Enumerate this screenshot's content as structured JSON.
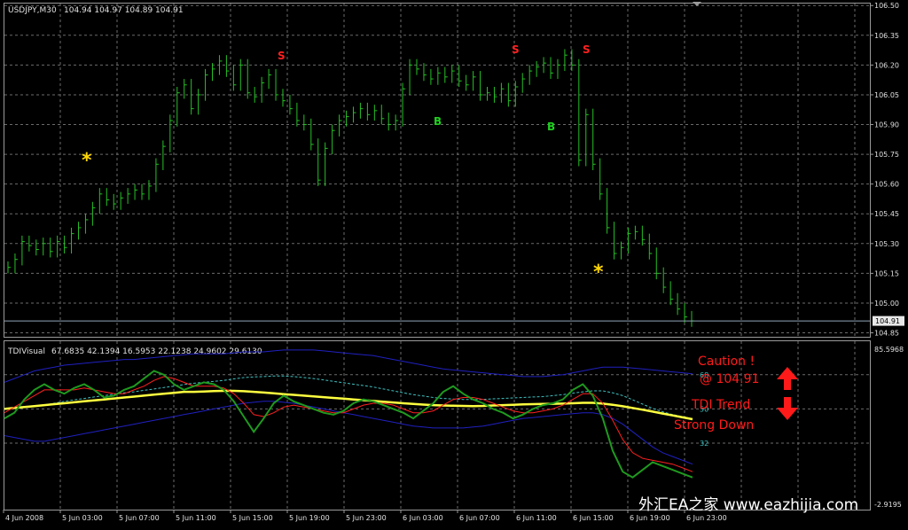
{
  "main_header": {
    "symbol": "USDJPY,M30",
    "ohlc": "104.94 104.97 104.89 104.91"
  },
  "indicator_header": {
    "name": "TDIVisual",
    "values": "67.6835 42.1394 16.5953 22.1238 24.9602 29.6130"
  },
  "price_axis": {
    "ticks": [
      "106.50",
      "106.35",
      "106.20",
      "106.05",
      "105.90",
      "105.75",
      "105.60",
      "105.45",
      "105.30",
      "105.15",
      "105.00",
      "104.85"
    ],
    "current_price": "104.91"
  },
  "indicator_axis": {
    "top_value": "85.5968",
    "bottom_value": "-2.9195",
    "levels": [
      {
        "value": 68,
        "label": "68"
      },
      {
        "value": 50,
        "label": "50"
      },
      {
        "value": 32,
        "label": "32"
      }
    ]
  },
  "time_axis": {
    "labels": [
      "4 Jun 2008",
      "5 Jun 03:00",
      "5 Jun 07:00",
      "5 Jun 11:00",
      "5 Jun 15:00",
      "5 Jun 19:00",
      "5 Jun 23:00",
      "6 Jun 03:00",
      "6 Jun 07:00",
      "6 Jun 11:00",
      "6 Jun 15:00",
      "6 Jun 19:00",
      "6 Jun 23:00"
    ]
  },
  "annotations": {
    "caution_label": "Caution !",
    "caution_price": "@ 104.91",
    "trend_line1": "TDI Trend",
    "trend_line2": "Strong Down"
  },
  "markers": [
    {
      "type": "star",
      "label": "*"
    },
    {
      "type": "sell",
      "label": "S"
    },
    {
      "type": "sell",
      "label": "S"
    },
    {
      "type": "sell",
      "label": "S"
    },
    {
      "type": "buy",
      "label": "B"
    },
    {
      "type": "buy",
      "label": "B"
    },
    {
      "type": "star",
      "label": "*"
    }
  ],
  "watermark": "外汇EA之家 www.eazhijia.com",
  "colors": {
    "background": "#000000",
    "grid": "#6b6b6b",
    "bars": "#26c026",
    "sell": "#ff2020",
    "buy": "#20d020",
    "star": "#ffd800",
    "rsi_price": "#1f9a1f",
    "signal": "#ff2020",
    "market_base": "#ffff40",
    "bands": "#2020c0",
    "mid_band": "#40c0c0",
    "annotation": "#ff1a1a"
  },
  "chart_data": {
    "type": "line",
    "price_range": [
      104.83,
      106.51
    ],
    "indicator_range": [
      -2.9195,
      85.5968
    ],
    "price_bars_close": [
      105.18,
      105.22,
      105.31,
      105.29,
      105.27,
      105.3,
      105.26,
      105.31,
      105.28,
      105.35,
      105.38,
      105.42,
      105.48,
      105.55,
      105.52,
      105.5,
      105.53,
      105.55,
      105.57,
      105.55,
      105.59,
      105.7,
      105.79,
      105.92,
      106.06,
      106.1,
      105.98,
      106.05,
      106.15,
      106.18,
      106.22,
      106.17,
      106.1,
      106.2,
      106.06,
      106.04,
      106.11,
      106.15,
      106.05,
      106.02,
      105.98,
      105.92,
      105.9,
      105.8,
      105.62,
      105.78,
      105.87,
      105.92,
      105.94,
      105.96,
      105.98,
      105.95,
      105.97,
      105.93,
      105.9,
      105.92,
      106.08,
      106.2,
      106.18,
      106.15,
      106.13,
      106.16,
      106.14,
      106.17,
      106.12,
      106.1,
      106.14,
      106.05,
      106.06,
      106.04,
      106.08,
      106.02,
      106.09,
      106.13,
      106.17,
      106.19,
      106.21,
      106.16,
      106.2,
      106.25,
      106.2,
      105.72,
      105.95,
      105.7,
      105.55,
      105.38,
      105.25,
      105.28,
      105.35,
      105.36,
      105.32,
      105.25,
      105.15,
      105.08,
      105.02,
      104.97,
      104.93,
      104.91
    ],
    "tdi_rsi_price": [
      45,
      48,
      55,
      60,
      63,
      60,
      58,
      61,
      63,
      60,
      56,
      57,
      60,
      62,
      66,
      70,
      68,
      63,
      60,
      62,
      64,
      63,
      60,
      54,
      46,
      38,
      45,
      53,
      57,
      54,
      52,
      50,
      48,
      47,
      49,
      53,
      55,
      54,
      52,
      50,
      48,
      45,
      49,
      53,
      59,
      62,
      58,
      55,
      53,
      50,
      48,
      45,
      47,
      50,
      52,
      53,
      55,
      60,
      63,
      57,
      45,
      28,
      17,
      14,
      18,
      22,
      20,
      18,
      16,
      14
    ],
    "tdi_signal": [
      48,
      51,
      54,
      57,
      60,
      60,
      60,
      60,
      61,
      60,
      59,
      58,
      58,
      60,
      62,
      65,
      67,
      66,
      64,
      62,
      62,
      62,
      61,
      58,
      53,
      47,
      46,
      48,
      51,
      52,
      51,
      50,
      49,
      48,
      48,
      50,
      52,
      53,
      53,
      52,
      50,
      48,
      48,
      49,
      52,
      55,
      56,
      56,
      55,
      53,
      51,
      49,
      48,
      48,
      49,
      50,
      52,
      55,
      58,
      58,
      53,
      44,
      34,
      27,
      24,
      23,
      22,
      21,
      19,
      17
    ],
    "tdi_market_base": [
      50,
      50.5,
      51,
      51.5,
      52,
      52.5,
      53,
      53.5,
      54,
      54.5,
      55,
      55.5,
      56,
      56.5,
      57,
      57.5,
      58,
      58.5,
      59,
      59,
      59.2,
      59.4,
      59.5,
      59.5,
      59.3,
      59,
      58.6,
      58.2,
      57.8,
      57.4,
      57,
      56.6,
      56.2,
      55.8,
      55.4,
      55,
      54.6,
      54.2,
      53.8,
      53.4,
      53,
      52.6,
      52.3,
      52,
      51.8,
      51.7,
      51.6,
      51.5,
      51.6,
      51.8,
      52,
      52.2,
      52.4,
      52.5,
      52.6,
      52.7,
      52.8,
      53,
      53.2,
      53.2,
      52.8,
      52.2,
      51.4,
      50.5,
      49.6,
      48.6,
      47.6,
      46.6,
      45.6,
      44.6
    ],
    "tdi_upper_band": [
      64,
      66,
      68,
      70,
      71,
      72,
      73,
      73.5,
      74,
      74.5,
      75,
      75.5,
      76,
      76,
      76.5,
      77,
      77.5,
      78,
      78.5,
      79,
      79,
      79,
      79,
      79.5,
      80,
      80,
      80,
      80.5,
      81,
      81,
      81,
      81,
      80.5,
      80,
      79.5,
      79,
      78.5,
      78,
      77,
      76,
      75,
      74,
      73,
      72,
      71,
      70.5,
      70,
      69.5,
      69,
      68.5,
      68,
      67.5,
      67,
      67,
      67,
      67.5,
      68,
      69,
      70,
      71,
      72,
      72,
      72,
      71.5,
      71,
      70.5,
      70,
      69.5,
      69,
      68.5
    ],
    "tdi_lower_band": [
      36,
      35,
      34,
      33,
      33,
      34,
      35,
      36,
      37,
      38,
      39,
      40,
      41,
      42,
      43,
      44,
      45,
      46,
      47,
      48,
      49,
      50,
      51,
      52,
      53,
      53.5,
      54,
      54,
      53.5,
      53,
      52,
      51,
      50,
      49,
      48,
      47,
      46,
      45,
      44,
      43,
      42,
      41,
      40.5,
      40,
      40,
      40,
      40,
      40.5,
      41,
      42,
      43,
      44,
      45,
      45.5,
      46,
      46.5,
      47,
      47.5,
      48,
      48,
      47,
      45,
      42,
      38,
      34,
      30,
      27,
      25,
      23,
      21
    ],
    "tdi_mid_band": [
      50,
      50.5,
      51,
      51.5,
      52,
      53,
      54,
      54.8,
      55.5,
      56.3,
      57,
      57.8,
      58.5,
      59,
      59.8,
      60.5,
      61.3,
      62,
      62.8,
      63.5,
      64,
      64.5,
      65,
      65.8,
      66.5,
      66.8,
      67,
      67.3,
      67.3,
      67,
      66.5,
      66,
      65.3,
      64.5,
      63.8,
      63,
      62.3,
      61.5,
      60.5,
      59.5,
      58.5,
      57.5,
      56.8,
      56,
      55.5,
      55.2,
      55,
      55,
      55,
      55.3,
      55.5,
      55.8,
      56,
      56.3,
      56.5,
      57,
      57.5,
      58.3,
      59,
      59.5,
      59.5,
      58.5,
      57,
      54.8,
      52.5,
      50.3,
      48.5,
      47,
      46,
      44.8
    ]
  }
}
